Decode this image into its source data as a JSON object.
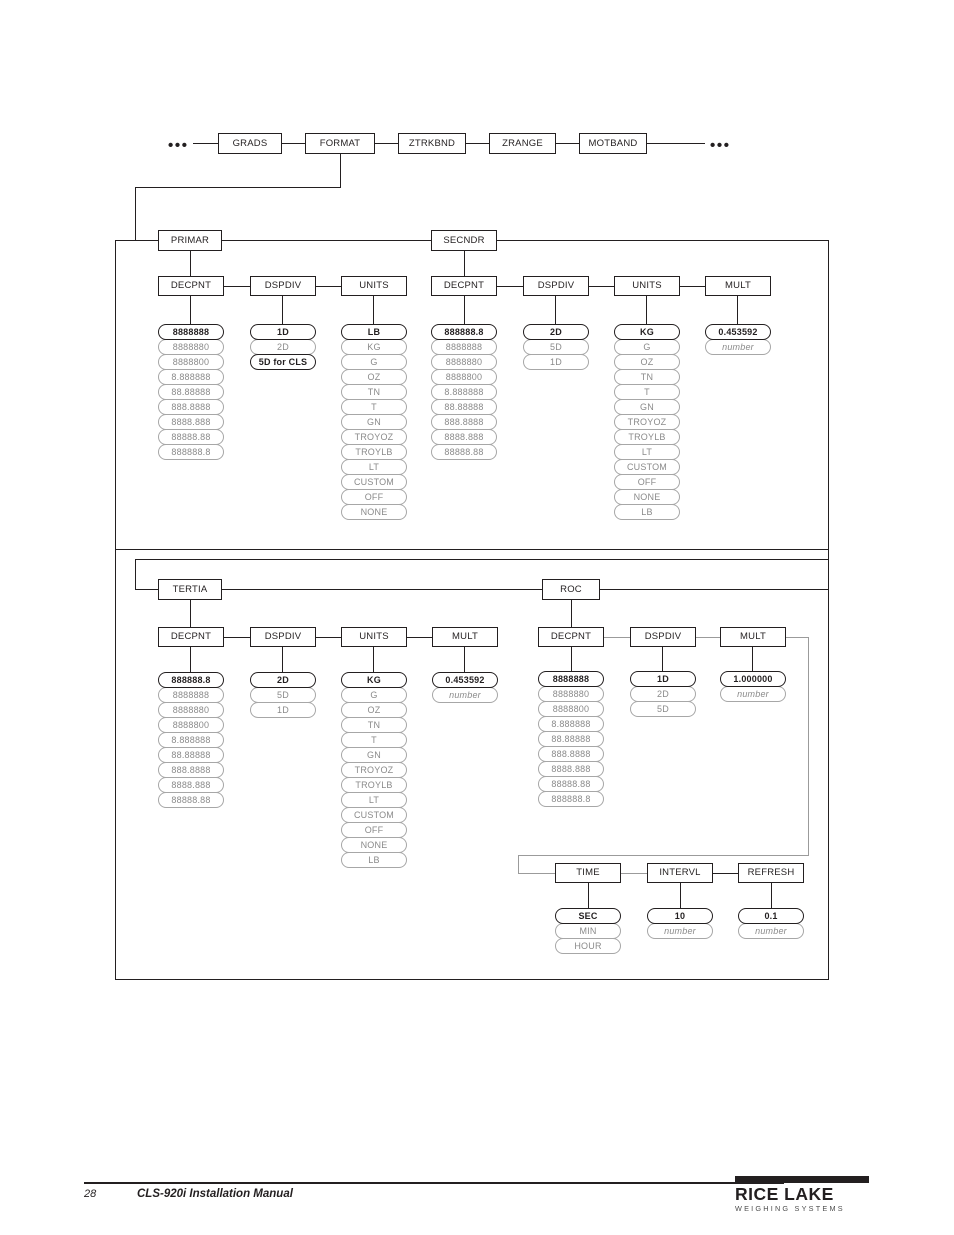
{
  "top_row": {
    "left_ellipsis": "•••",
    "right_ellipsis": "•••",
    "boxes": [
      {
        "label": "GRADS"
      },
      {
        "label": "FORMAT"
      },
      {
        "label": "ZTRKBND"
      },
      {
        "label": "ZRANGE"
      },
      {
        "label": "MOTBAND"
      }
    ]
  },
  "primar": {
    "label": "PRIMAR",
    "decpnt": {
      "label": "DECPNT",
      "options": [
        "8888888",
        "8888880",
        "8888800",
        "8.888888",
        "88.88888",
        "888.8888",
        "8888.888",
        "88888.88",
        "888888.8"
      ]
    },
    "dspdiv": {
      "label": "DSPDIV",
      "options": [
        "1D",
        "2D",
        "5D for CLS"
      ]
    },
    "units": {
      "label": "UNITS",
      "options": [
        "LB",
        "KG",
        "G",
        "OZ",
        "TN",
        "T",
        "GN",
        "TROYOZ",
        "TROYLB",
        "LT",
        "CUSTOM",
        "OFF",
        "NONE"
      ]
    }
  },
  "secndr": {
    "label": "SECNDR",
    "decpnt": {
      "label": "DECPNT",
      "options": [
        "888888.8",
        "8888888",
        "8888880",
        "8888800",
        "8.888888",
        "88.88888",
        "888.8888",
        "8888.888",
        "88888.88"
      ]
    },
    "dspdiv": {
      "label": "DSPDIV",
      "options": [
        "2D",
        "5D",
        "1D"
      ]
    },
    "units": {
      "label": "UNITS",
      "options": [
        "KG",
        "G",
        "OZ",
        "TN",
        "T",
        "GN",
        "TROYOZ",
        "TROYLB",
        "LT",
        "CUSTOM",
        "OFF",
        "NONE",
        "LB"
      ]
    },
    "mult": {
      "label": "MULT",
      "options": [
        "0.453592",
        "number"
      ]
    }
  },
  "tertia": {
    "label": "TERTIA",
    "decpnt": {
      "label": "DECPNT",
      "options": [
        "888888.8",
        "8888888",
        "8888880",
        "8888800",
        "8.888888",
        "88.88888",
        "888.8888",
        "8888.888",
        "88888.88"
      ]
    },
    "dspdiv": {
      "label": "DSPDIV",
      "options": [
        "2D",
        "5D",
        "1D"
      ]
    },
    "units": {
      "label": "UNITS",
      "options": [
        "KG",
        "G",
        "OZ",
        "TN",
        "T",
        "GN",
        "TROYOZ",
        "TROYLB",
        "LT",
        "CUSTOM",
        "OFF",
        "NONE",
        "LB"
      ]
    },
    "mult": {
      "label": "MULT",
      "options": [
        "0.453592",
        "number"
      ]
    }
  },
  "roc": {
    "label": "ROC",
    "decpnt": {
      "label": "DECPNT",
      "options": [
        "8888888",
        "8888880",
        "8888800",
        "8.888888",
        "88.88888",
        "888.8888",
        "8888.888",
        "88888.88",
        "888888.8"
      ]
    },
    "dspdiv": {
      "label": "DSPDIV",
      "options": [
        "1D",
        "2D",
        "5D"
      ]
    },
    "mult": {
      "label": "MULT",
      "options": [
        "1.000000",
        "number"
      ]
    },
    "time": {
      "label": "TIME",
      "options": [
        "SEC",
        "MIN",
        "HOUR"
      ]
    },
    "intervl": {
      "label": "INTERVL",
      "options": [
        "10",
        "number"
      ]
    },
    "refresh": {
      "label": "REFRESH",
      "options": [
        "0.1",
        "number"
      ]
    }
  },
  "footer": {
    "page_number": "28",
    "title": "CLS-920i Installation Manual",
    "logo_name": "RICE LAKE",
    "logo_tagline": "WEIGHING SYSTEMS"
  },
  "colors": {
    "line": "#231f20",
    "option_gray": "#8a8a8a",
    "option_border": "#a7a7a7"
  }
}
